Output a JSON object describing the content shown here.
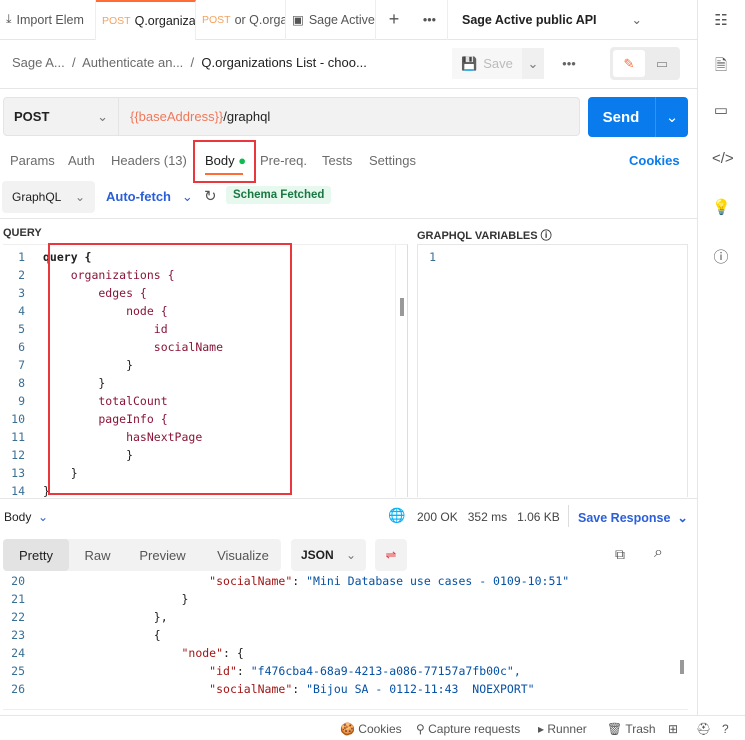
{
  "tabs": [
    {
      "label": "Import Elem",
      "icon": "import-icon"
    },
    {
      "method": "POST",
      "label": "Q.organiza",
      "active": true
    },
    {
      "method": "POST",
      "label": "or Q.organ"
    },
    {
      "label": "Sage Active",
      "icon": "collection-icon"
    }
  ],
  "environment": "Sage Active public API",
  "breadcrumb": [
    "Sage A...",
    "Authenticate an...",
    "Q.organizations List - choo..."
  ],
  "save_label": "Save",
  "request": {
    "method": "POST",
    "url_var": "{{baseAddress}}",
    "url_path": "/graphql",
    "send_label": "Send"
  },
  "req_tabs": [
    "Params",
    "Auth",
    "Headers (13)",
    "Body",
    "Pre-req.",
    "Tests",
    "Settings"
  ],
  "cookies_label": "Cookies",
  "body_mode": "GraphQL",
  "autofetch": "Auto-fetch",
  "schema_status": "Schema Fetched",
  "query_label": "QUERY",
  "variables_label": "GRAPHQL VARIABLES",
  "query_lines": [
    [
      0,
      "query {"
    ],
    [
      1,
      "organizations {"
    ],
    [
      2,
      "edges {"
    ],
    [
      3,
      "node {"
    ],
    [
      4,
      "id"
    ],
    [
      4,
      "socialName"
    ],
    [
      3,
      "}"
    ],
    [
      2,
      "}"
    ],
    [
      2,
      "totalCount"
    ],
    [
      2,
      "pageInfo {"
    ],
    [
      3,
      "hasNextPage"
    ],
    [
      3,
      "}"
    ],
    [
      1,
      "}"
    ],
    [
      0,
      "}"
    ]
  ],
  "variables_lines": [
    "1"
  ],
  "response": {
    "label": "Body",
    "status": "200 OK",
    "time": "352 ms",
    "size": "1.06 KB",
    "save_label": "Save Response",
    "views": [
      "Pretty",
      "Raw",
      "Preview",
      "Visualize"
    ],
    "format": "JSON",
    "lines": [
      {
        "n": "20",
        "indent": 6,
        "k": "\"socialName\"",
        "v": "\"Mini Database use cases - 0109-10:51\""
      },
      {
        "n": "21",
        "indent": 5,
        "t": "}"
      },
      {
        "n": "22",
        "indent": 4,
        "t": "},"
      },
      {
        "n": "23",
        "indent": 4,
        "t": "{"
      },
      {
        "n": "24",
        "indent": 5,
        "k": "\"node\"",
        "t": ": {"
      },
      {
        "n": "25",
        "indent": 6,
        "k": "\"id\"",
        "v": "\"f476cba4-68a9-4213-a086-77157a7fb00c\","
      },
      {
        "n": "26",
        "indent": 6,
        "k": "\"socialName\"",
        "v": "\"Bijou SA - 0112-11:43  NOEXPORT\""
      }
    ]
  },
  "footer": [
    "Cookies",
    "Capture requests",
    "Runner",
    "Trash"
  ],
  "colors": {
    "accent": "#ff6c37",
    "send": "#097bed",
    "annotation": "#e8383d"
  }
}
